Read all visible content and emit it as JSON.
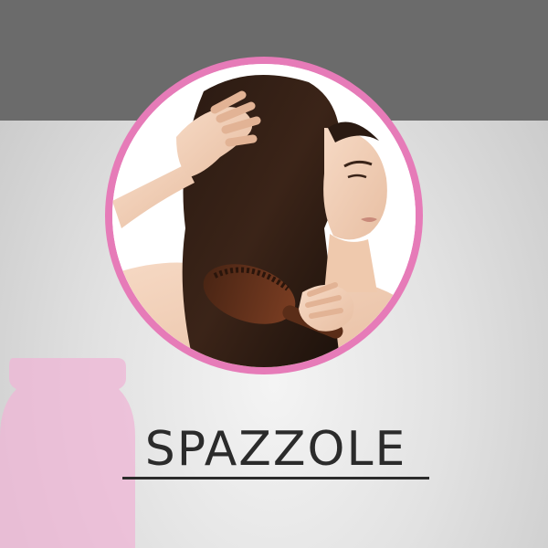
{
  "category": {
    "label": "SPAZZOLE",
    "image_icon": "hair-brushing-photo-icon",
    "decor_icon": "jar-icon"
  },
  "colors": {
    "top_band": "#6b6b6b",
    "ring": "#e67bb8",
    "jar": "#efb6d6",
    "text": "#2b2b2b"
  }
}
